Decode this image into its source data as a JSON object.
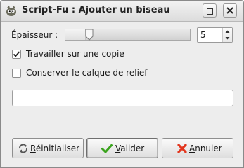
{
  "window": {
    "title": "Script-Fu : Ajouter un biseau",
    "icon": "gimp-wilber-icon"
  },
  "thickness": {
    "label": "Épaisseur :",
    "value": "5",
    "slider_fraction": 0.17
  },
  "options": [
    {
      "label": "Travailler sur une copie",
      "checked": true
    },
    {
      "label": "Conserver le calque de relief",
      "checked": false
    }
  ],
  "progress_entry": {
    "value": ""
  },
  "buttons": {
    "reset": {
      "mnemonic": "R",
      "rest": "éinitialiser",
      "icon": "reset-icon"
    },
    "ok": {
      "mnemonic": "V",
      "rest": "alider",
      "icon": "checkmark-icon"
    },
    "cancel": {
      "mnemonic": "A",
      "rest": "nnuler",
      "icon": "cancel-x-icon"
    }
  },
  "colors": {
    "ok_check": "#3aa31d",
    "cancel_x": "#e2361e"
  }
}
